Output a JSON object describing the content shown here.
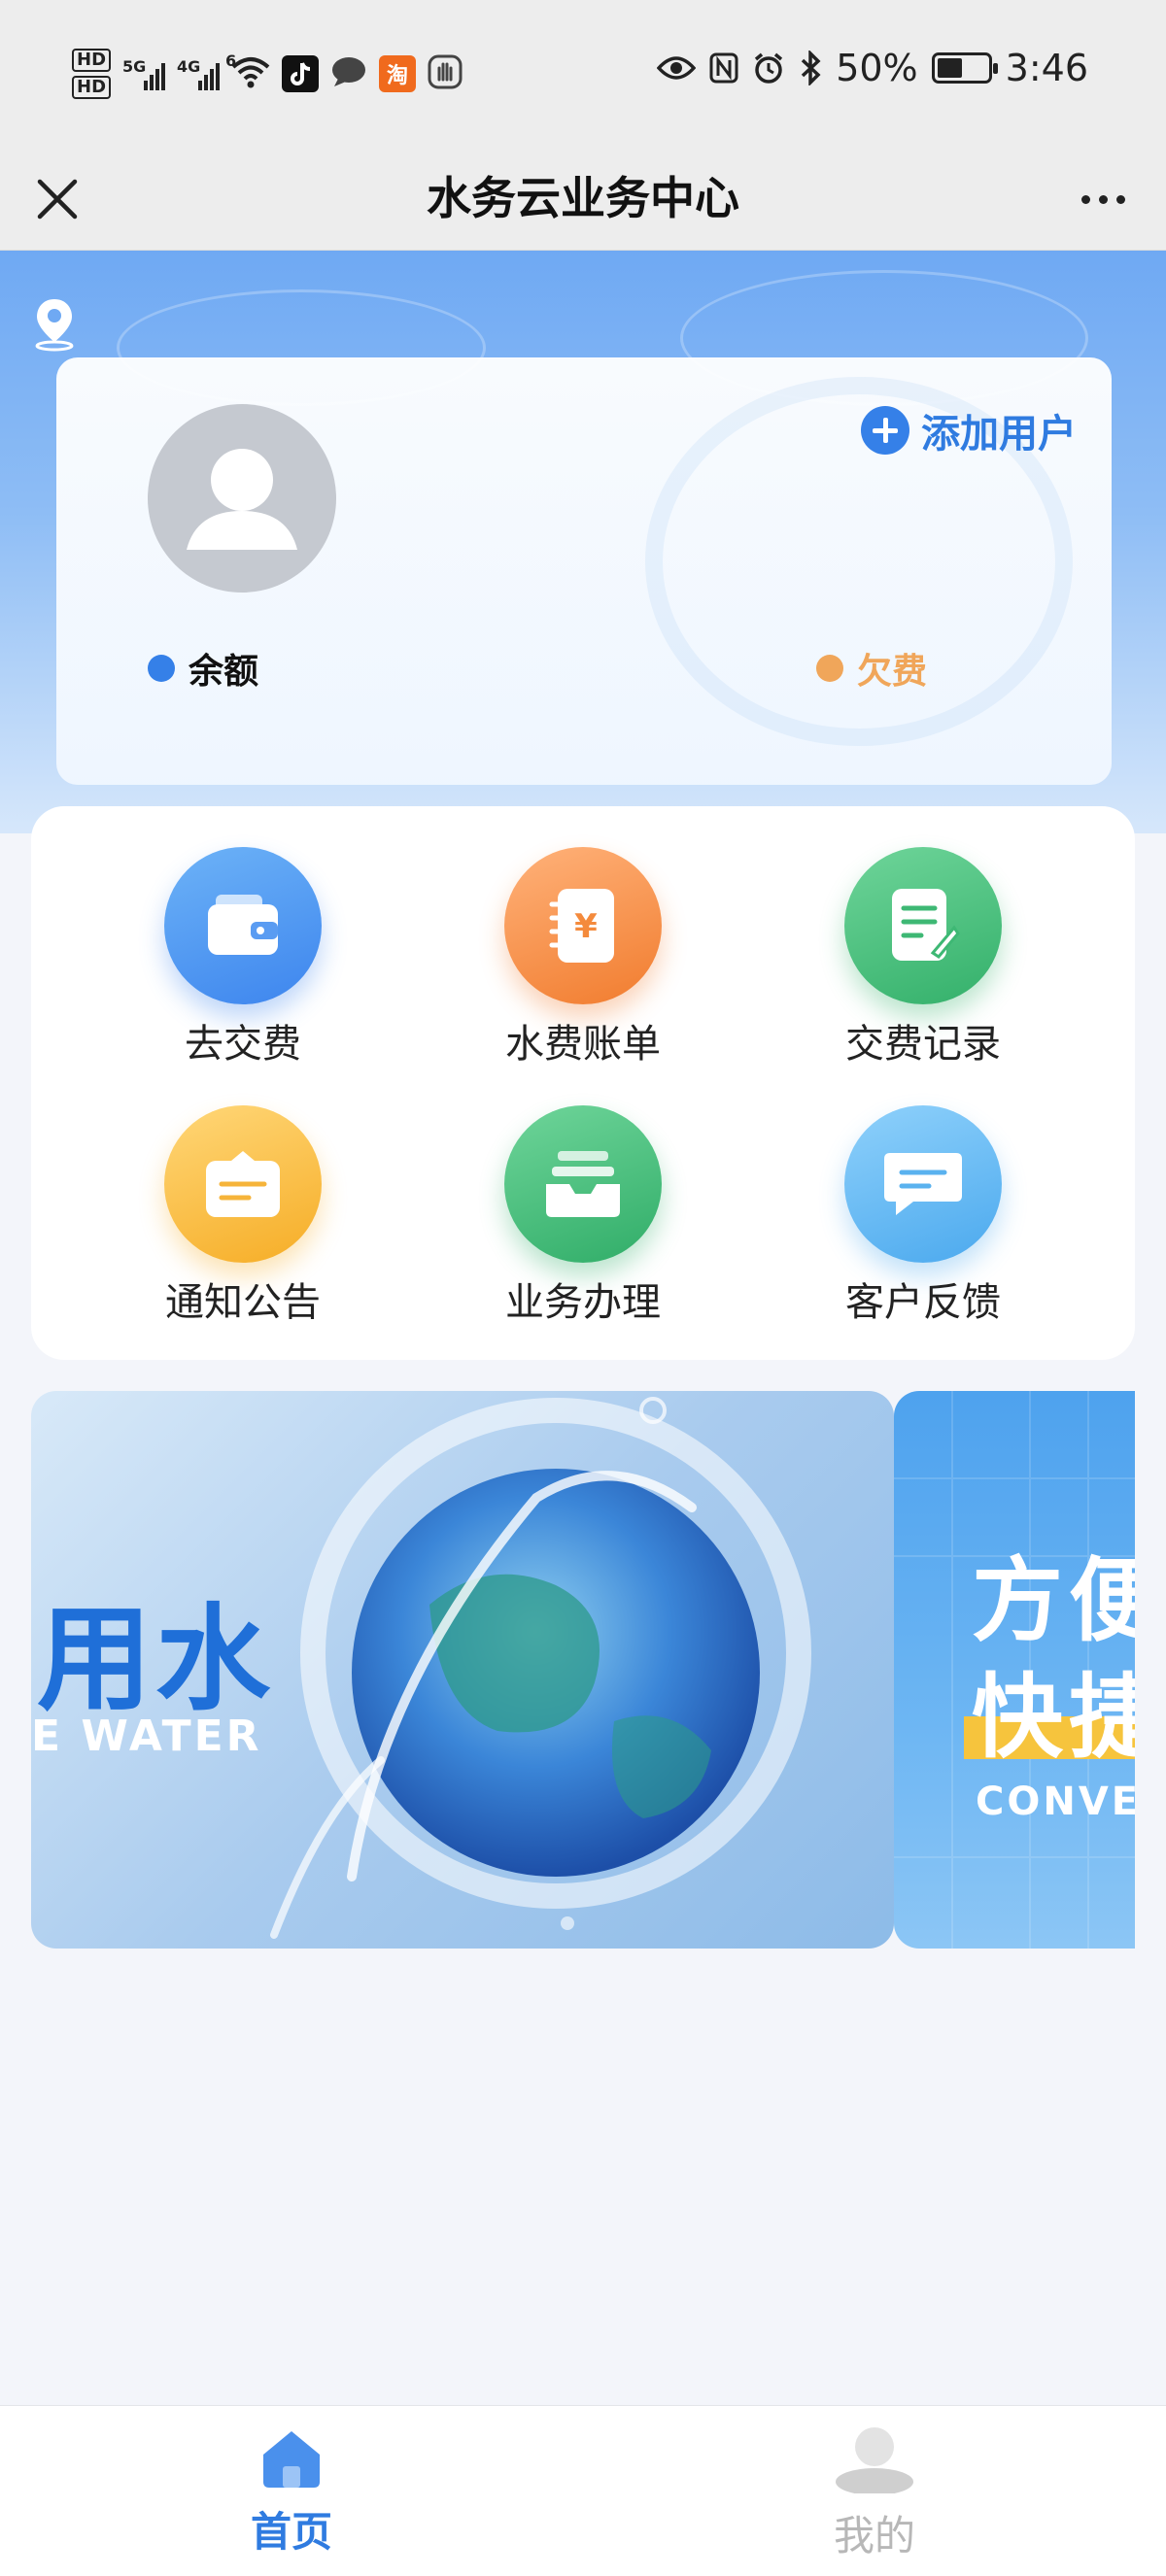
{
  "status_bar": {
    "hd1": "HD",
    "hd2": "HD",
    "net1": "5G",
    "net2": "4G",
    "wifi_gen": "6",
    "taobao_badge": "淘",
    "battery": "50%",
    "battery_level": 0.5,
    "time": "3:46",
    "icons": [
      "eye-icon",
      "nfc-icon",
      "alarm-icon",
      "bluetooth-icon"
    ]
  },
  "header": {
    "title": "水务云业务中心"
  },
  "user_card": {
    "add_user_label": "添加用户",
    "balance_label": "余额",
    "arrears_label": "欠费",
    "balance_dot_color": "#3580e8",
    "arrears_dot_color": "#f0a65a"
  },
  "services": [
    {
      "label": "去交费",
      "icon": "wallet-icon",
      "color_from": "#6db3f7",
      "color_to": "#3d85ee"
    },
    {
      "label": "水费账单",
      "icon": "bill-icon",
      "color_from": "#ffb27a",
      "color_to": "#f17c2e"
    },
    {
      "label": "交费记录",
      "icon": "record-icon",
      "color_from": "#6fd59a",
      "color_to": "#33b06a"
    },
    {
      "label": "通知公告",
      "icon": "notice-icon",
      "color_from": "#ffd778",
      "color_to": "#f6ad26"
    },
    {
      "label": "业务办理",
      "icon": "inbox-icon",
      "color_from": "#6fd59a",
      "color_to": "#30ad68"
    },
    {
      "label": "客户反馈",
      "icon": "feedback-icon",
      "color_from": "#8fd1fb",
      "color_to": "#4ba9ee"
    }
  ],
  "banners": {
    "main_headline": "用水",
    "main_sub": "E WATER",
    "side_line1": "方便",
    "side_line2": "快捷",
    "side_sub": "CONVE"
  },
  "tab_bar": {
    "home_label": "首页",
    "mine_label": "我的",
    "active_color": "#2f7be0",
    "inactive_color": "#b7b7b7"
  }
}
